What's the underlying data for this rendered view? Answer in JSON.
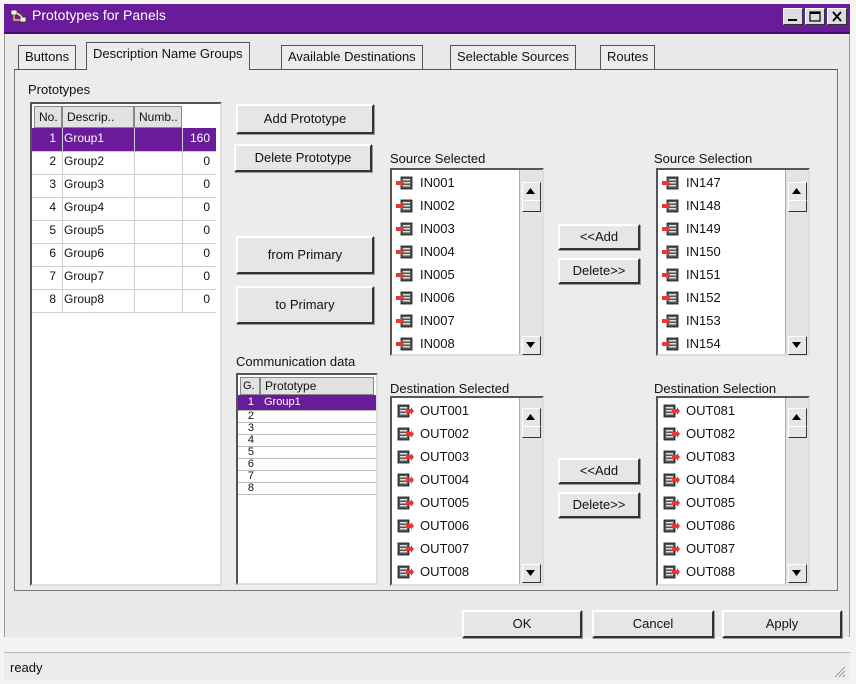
{
  "window": {
    "title": "Prototypes for Panels",
    "accent_color": "#6a1b9a"
  },
  "tabs": [
    {
      "label": "Buttons",
      "active": false
    },
    {
      "label": "Description Name Groups",
      "active": true
    },
    {
      "label": "Available Destinations",
      "active": false
    },
    {
      "label": "Selectable Sources",
      "active": false
    },
    {
      "label": "Routes",
      "active": false
    }
  ],
  "prototypes": {
    "label": "Prototypes",
    "columns": [
      "No.",
      "Descrip..",
      "Numb.."
    ],
    "rows": [
      {
        "no": "1",
        "desc": "Group1",
        "num": "160",
        "selected": true
      },
      {
        "no": "2",
        "desc": "Group2",
        "num": "0"
      },
      {
        "no": "3",
        "desc": "Group3",
        "num": "0"
      },
      {
        "no": "4",
        "desc": "Group4",
        "num": "0"
      },
      {
        "no": "5",
        "desc": "Group5",
        "num": "0"
      },
      {
        "no": "6",
        "desc": "Group6",
        "num": "0"
      },
      {
        "no": "7",
        "desc": "Group7",
        "num": "0"
      },
      {
        "no": "8",
        "desc": "Group8",
        "num": "0"
      }
    ]
  },
  "buttons": {
    "add_prototype": "Add Prototype",
    "delete_prototype": "Delete Prototype",
    "from_primary": "from Primary",
    "to_primary": "to Primary",
    "add_source": "<<Add",
    "delete_source": "Delete>>",
    "add_dest": "<<Add",
    "delete_dest": "Delete>>",
    "ok": "OK",
    "cancel": "Cancel",
    "apply": "Apply"
  },
  "communication": {
    "label": "Communication data",
    "columns": [
      "G.",
      "Prototype"
    ],
    "rows": [
      {
        "g": "1",
        "prototype": "Group1",
        "selected": true
      },
      {
        "g": "2",
        "prototype": ""
      },
      {
        "g": "3",
        "prototype": ""
      },
      {
        "g": "4",
        "prototype": ""
      },
      {
        "g": "5",
        "prototype": ""
      },
      {
        "g": "6",
        "prototype": ""
      },
      {
        "g": "7",
        "prototype": ""
      },
      {
        "g": "8",
        "prototype": ""
      }
    ]
  },
  "source_selected": {
    "label": "Source Selected",
    "items": [
      "IN001",
      "IN002",
      "IN003",
      "IN004",
      "IN005",
      "IN006",
      "IN007",
      "IN008"
    ]
  },
  "source_selection": {
    "label": "Source Selection",
    "items": [
      "IN147",
      "IN148",
      "IN149",
      "IN150",
      "IN151",
      "IN152",
      "IN153",
      "IN154"
    ]
  },
  "destination_selected": {
    "label": "Destination Selected",
    "items": [
      "OUT001",
      "OUT002",
      "OUT003",
      "OUT004",
      "OUT005",
      "OUT006",
      "OUT007",
      "OUT008"
    ]
  },
  "destination_selection": {
    "label": "Destination Selection",
    "items": [
      "OUT081",
      "OUT082",
      "OUT083",
      "OUT084",
      "OUT085",
      "OUT086",
      "OUT087",
      "OUT088"
    ]
  },
  "status": {
    "text": "ready"
  }
}
